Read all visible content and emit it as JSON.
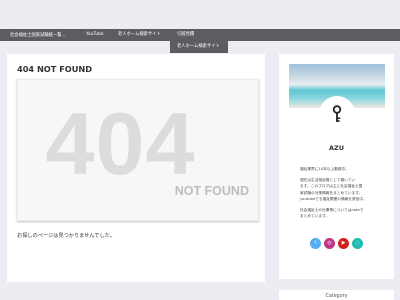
{
  "nav": {
    "items": [
      {
        "label": "社会福祉士国家試験統一覧",
        "caret": "⌄"
      },
      {
        "label": "YouTube"
      },
      {
        "label": "老人ホーム検索サイト"
      },
      {
        "label": "引越見積"
      }
    ],
    "submenu": [
      "老人ホーム検索サイト"
    ]
  },
  "main": {
    "title": "404 NOT FOUND",
    "error_code": "404",
    "error_text": "NOT FOUND",
    "message": "お探しのページは見つかりませんでした。"
  },
  "profile": {
    "name": "AZU",
    "bio": [
      "福祉業界に10年以上勤務中。",
      "現在は生活相談員として働いてい",
      "ます。このブログは主に社会福祉士国",
      "家試験の対策情報をまとめています。",
      "youtubeでも福祉関連の情報を発信中。",
      "社会福祉士の仕事等についてはnoteで",
      "まとめています。"
    ],
    "social": [
      {
        "icon": "twitter-icon",
        "glyph": "t",
        "color": "#55acee"
      },
      {
        "icon": "instagram-icon",
        "glyph": "◎",
        "color": "#c13584"
      },
      {
        "icon": "youtube-icon",
        "glyph": "▶",
        "color": "#cd201f"
      },
      {
        "icon": "line-icon",
        "glyph": "◌",
        "color": "#1dbbb0"
      }
    ]
  },
  "sidebar2": {
    "title": "Category"
  }
}
